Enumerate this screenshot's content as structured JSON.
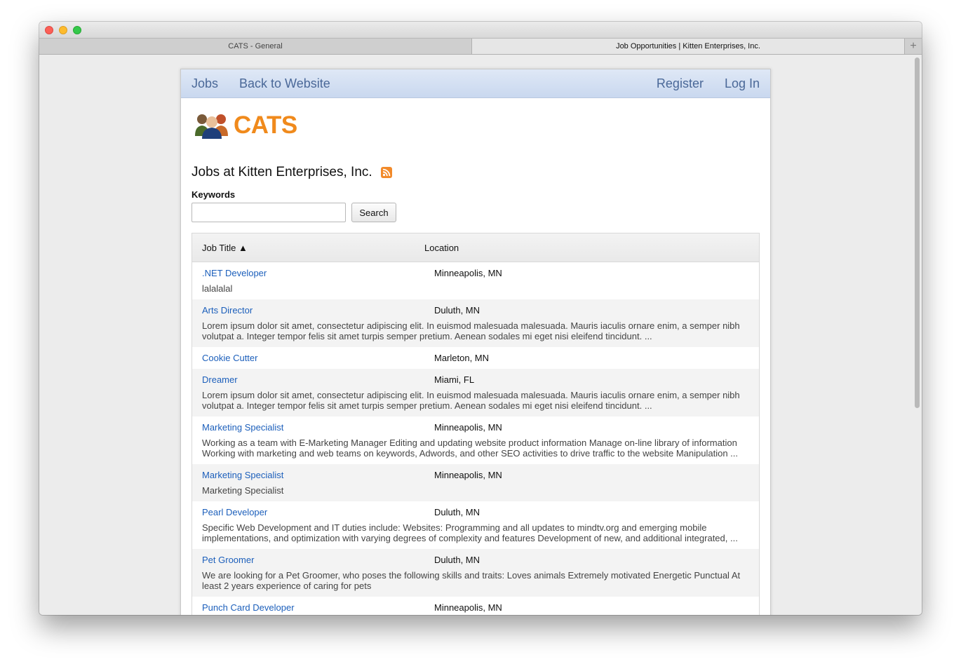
{
  "browser": {
    "tabs": [
      {
        "label": "CATS - General"
      },
      {
        "label": "Job Opportunities | Kitten Enterprises, Inc."
      }
    ],
    "new_tab_symbol": "+"
  },
  "nav": {
    "jobs": "Jobs",
    "back_to_website": "Back to Website",
    "register": "Register",
    "log_in": "Log In"
  },
  "logo": {
    "text": "CATS"
  },
  "heading": "Jobs at Kitten Enterprises, Inc.",
  "search": {
    "keywords_label": "Keywords",
    "keywords_value": "",
    "button": "Search"
  },
  "table": {
    "headers": {
      "job_title": "Job Title ▲",
      "location": "Location"
    },
    "rows": [
      {
        "title": ".NET Developer",
        "location": "Minneapolis, MN",
        "description": "lalalalal"
      },
      {
        "title": "Arts Director",
        "location": "Duluth, MN",
        "description": "Lorem ipsum dolor sit amet, consectetur adipiscing elit. In euismod malesuada malesuada. Mauris iaculis ornare enim, a semper nibh volutpat a. Integer tempor felis sit amet turpis semper pretium. Aenean sodales mi eget nisi eleifend tincidunt. ..."
      },
      {
        "title": "Cookie Cutter",
        "location": "Marleton, MN",
        "description": ""
      },
      {
        "title": "Dreamer",
        "location": "Miami, FL",
        "description": "Lorem ipsum dolor sit amet, consectetur adipiscing elit. In euismod malesuada malesuada. Mauris iaculis ornare enim, a semper nibh volutpat a. Integer tempor felis sit amet turpis semper pretium. Aenean sodales mi eget nisi eleifend tincidunt. ..."
      },
      {
        "title": "Marketing Specialist",
        "location": "Minneapolis, MN",
        "description": "Working as a team with E-Marketing Manager Editing and updating website product information Manage on-line library of information Working with marketing and web teams on keywords, Adwords, and other SEO activities to drive traffic to the website Manipulation ..."
      },
      {
        "title": "Marketing Specialist",
        "location": "Minneapolis, MN",
        "description": "Marketing Specialist"
      },
      {
        "title": "Pearl Developer",
        "location": "Duluth, MN",
        "description": "Specific Web Development and IT duties include: Websites: Programming and all updates to mindtv.org and emerging mobile implementations, and optimization with varying degrees of complexity and features Development of new, and additional integrated, ..."
      },
      {
        "title": "Pet Groomer",
        "location": "Duluth, MN",
        "description": "We are looking for a Pet Groomer, who poses the following skills and traits: Loves animals Extremely motivated Energetic Punctual At least 2 years experience of caring for pets"
      },
      {
        "title": "Punch Card Developer",
        "location": "Minneapolis, MN",
        "description": ""
      }
    ]
  },
  "colors": {
    "link": "#1c5fbb",
    "nav_link": "#4a6898",
    "logo": "#f08a1c",
    "navbar_bg": "#d3dff2",
    "alt_row_bg": "#f3f3f3"
  }
}
